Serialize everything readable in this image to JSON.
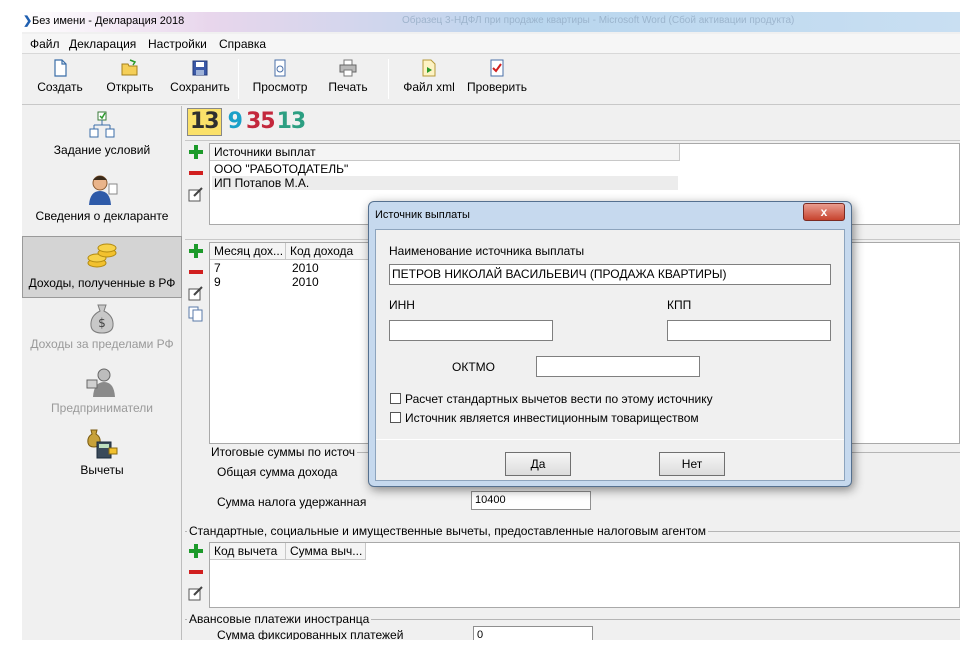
{
  "window": {
    "title": "Без имени - Декларация 2018",
    "background_title": "Образец 3-НДФЛ при продаже квартиры - Microsoft Word (Сбой активации продукта)"
  },
  "menu": [
    "Файл",
    "Декларация",
    "Настройки",
    "Справка"
  ],
  "toolbar": [
    {
      "label": "Создать",
      "icon": "new-document-icon"
    },
    {
      "label": "Открыть",
      "icon": "open-folder-icon"
    },
    {
      "label": "Сохранить",
      "icon": "save-floppy-icon"
    },
    {
      "label": "Просмотр",
      "icon": "preview-icon"
    },
    {
      "label": "Печать",
      "icon": "printer-icon"
    },
    {
      "label": "Файл xml",
      "icon": "xml-file-icon"
    },
    {
      "label": "Проверить",
      "icon": "check-document-icon"
    }
  ],
  "nav": [
    {
      "label": "Задание условий",
      "icon": "conditions-tree-icon",
      "state": "normal"
    },
    {
      "label": "Сведения о декларанте",
      "icon": "person-icon",
      "state": "normal"
    },
    {
      "label": "Доходы, полученные в РФ",
      "icon": "coins-icon",
      "state": "active"
    },
    {
      "label": "Доходы за пределами РФ",
      "icon": "money-bag-icon",
      "state": "disabled"
    },
    {
      "label": "Предприниматели",
      "icon": "businessman-icon",
      "state": "disabled"
    },
    {
      "label": "Вычеты",
      "icon": "deductions-icon",
      "state": "normal"
    }
  ],
  "rate_tabs": {
    "d1": "13",
    "d2": "9",
    "d3": "35",
    "d4": "13",
    "colors": {
      "d1_bg": "#fbe16a",
      "d2": "#1aa0c8",
      "d3": "#c3283c",
      "d4": "#2c9f82"
    }
  },
  "sources": {
    "header": "Источники выплат",
    "rows": [
      "ООО \"РАБОТОДАТЕЛЬ\"",
      "ИП Потапов М.А."
    ]
  },
  "income": {
    "headers": [
      "Месяц дох...",
      "Код дохода"
    ],
    "rows": [
      [
        "7",
        "2010"
      ],
      [
        "9",
        "2010"
      ]
    ]
  },
  "totals": {
    "title": "Итоговые суммы по источ",
    "total_income_label": "Общая сумма дохода",
    "tax_withheld_label": "Сумма налога удержанная",
    "tax_withheld_value": "10400"
  },
  "deductions": {
    "title": "Стандартные, социальные и имущественные вычеты, предоставленные налоговым агентом",
    "headers": [
      "Код вычета",
      "Сумма выч..."
    ]
  },
  "advance": {
    "title": "Авансовые платежи иностранца",
    "fixed_label": "Сумма фиксированных платежей",
    "fixed_value": "0"
  },
  "dialog": {
    "title": "Источник выплаты",
    "close_label": "x",
    "name_label": "Наименование источника выплаты",
    "name_value": "ПЕТРОВ НИКОЛАЙ ВАСИЛЬЕВИЧ (ПРОДАЖА КВАРТИРЫ)",
    "inn_label": "ИНН",
    "inn_value": "",
    "kpp_label": "КПП",
    "kpp_value": "",
    "oktmo_label": "ОКТМО",
    "oktmo_value": "",
    "check1": "Расчет стандартных вычетов вести по этому источнику",
    "check2": "Источник является инвестиционным товариществом",
    "yes": "Да",
    "no": "Нет"
  }
}
